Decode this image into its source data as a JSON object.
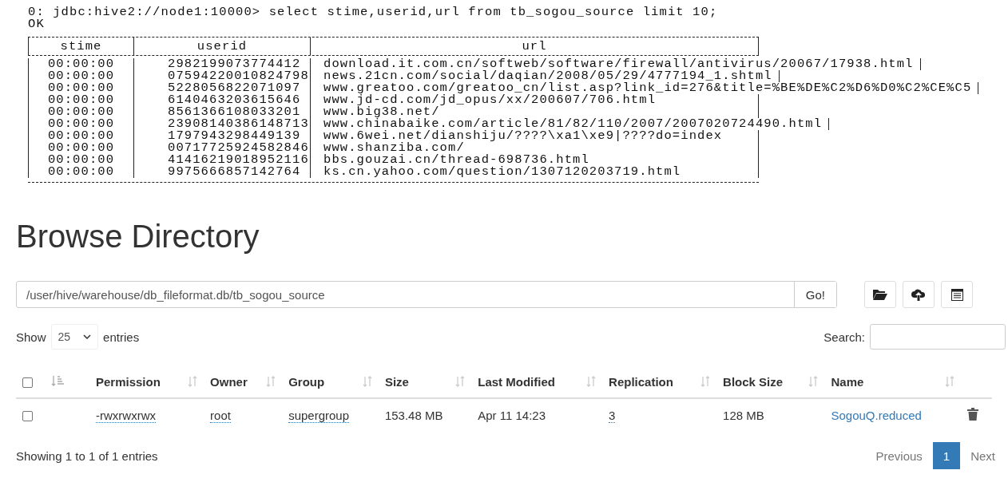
{
  "terminal": {
    "prompt_line": "0: jdbc:hive2://node1:10000> select stime,userid,url from tb_sogou_source limit 10;",
    "result_line": "OK",
    "table": {
      "columns": [
        "stime",
        "userid",
        "url"
      ],
      "rows": [
        [
          "00:00:00",
          "2982199073774412",
          "download.it.com.cn/softweb/software/firewall/antivirus/20067/17938.html"
        ],
        [
          "00:00:00",
          "07594220010824798",
          "news.21cn.com/social/daqian/2008/05/29/4777194_1.shtml"
        ],
        [
          "00:00:00",
          "5228056822071097",
          "www.greatoo.com/greatoo_cn/list.asp?link_id=276&title=%BE%DE%C2%D6%D0%C2%CE%C5"
        ],
        [
          "00:00:00",
          "6140463203615646",
          "www.jd-cd.com/jd_opus/xx/200607/706.html"
        ],
        [
          "00:00:00",
          "8561366108033201",
          "www.big38.net/"
        ],
        [
          "00:00:00",
          "23908140386148713",
          "www.chinabaike.com/article/81/82/110/2007/2007020724490.html"
        ],
        [
          "00:00:00",
          "1797943298449139",
          "www.6wei.net/dianshiju/????\\xa1\\xe9|????do=index"
        ],
        [
          "00:00:00",
          "00717725924582846",
          "www.shanziba.com/"
        ],
        [
          "00:00:00",
          "41416219018952116",
          "bbs.gouzai.cn/thread-698736.html"
        ],
        [
          "00:00:00",
          "9975666857142764",
          "ks.cn.yahoo.com/question/1307120203719.html"
        ]
      ]
    }
  },
  "browser": {
    "title": "Browse Directory",
    "path": "/user/hive/warehouse/db_fileformat.db/tb_sogou_source",
    "go_button": "Go!",
    "toolbar": [
      {
        "kind": "folder"
      },
      {
        "kind": "upload"
      },
      {
        "kind": "table"
      }
    ],
    "show_label": "Show",
    "page_length": "25",
    "entries_label": "entries",
    "search_label": "Search:",
    "select_all": {
      "checked": false
    },
    "columns": [
      {
        "label": "Permission"
      },
      {
        "label": "Owner"
      },
      {
        "label": "Group"
      },
      {
        "label": "Size"
      },
      {
        "label": "Last Modified"
      },
      {
        "label": "Replication"
      },
      {
        "label": "Block Size"
      },
      {
        "label": "Name"
      }
    ],
    "rows": [
      {
        "checked": false,
        "permission": "-rwxrwxrwx",
        "owner": "root",
        "group": "supergroup",
        "size": "153.48 MB",
        "last_modified": "Apr 11 14:23",
        "replication": "3",
        "block_size": "128 MB",
        "name": "SogouQ.reduced"
      }
    ],
    "info": "Showing 1 to 1 of 1 entries",
    "pagination": [
      {
        "label": "Previous",
        "selected": false
      },
      {
        "label": "1",
        "selected": true
      },
      {
        "label": "Next",
        "selected": false
      }
    ]
  }
}
